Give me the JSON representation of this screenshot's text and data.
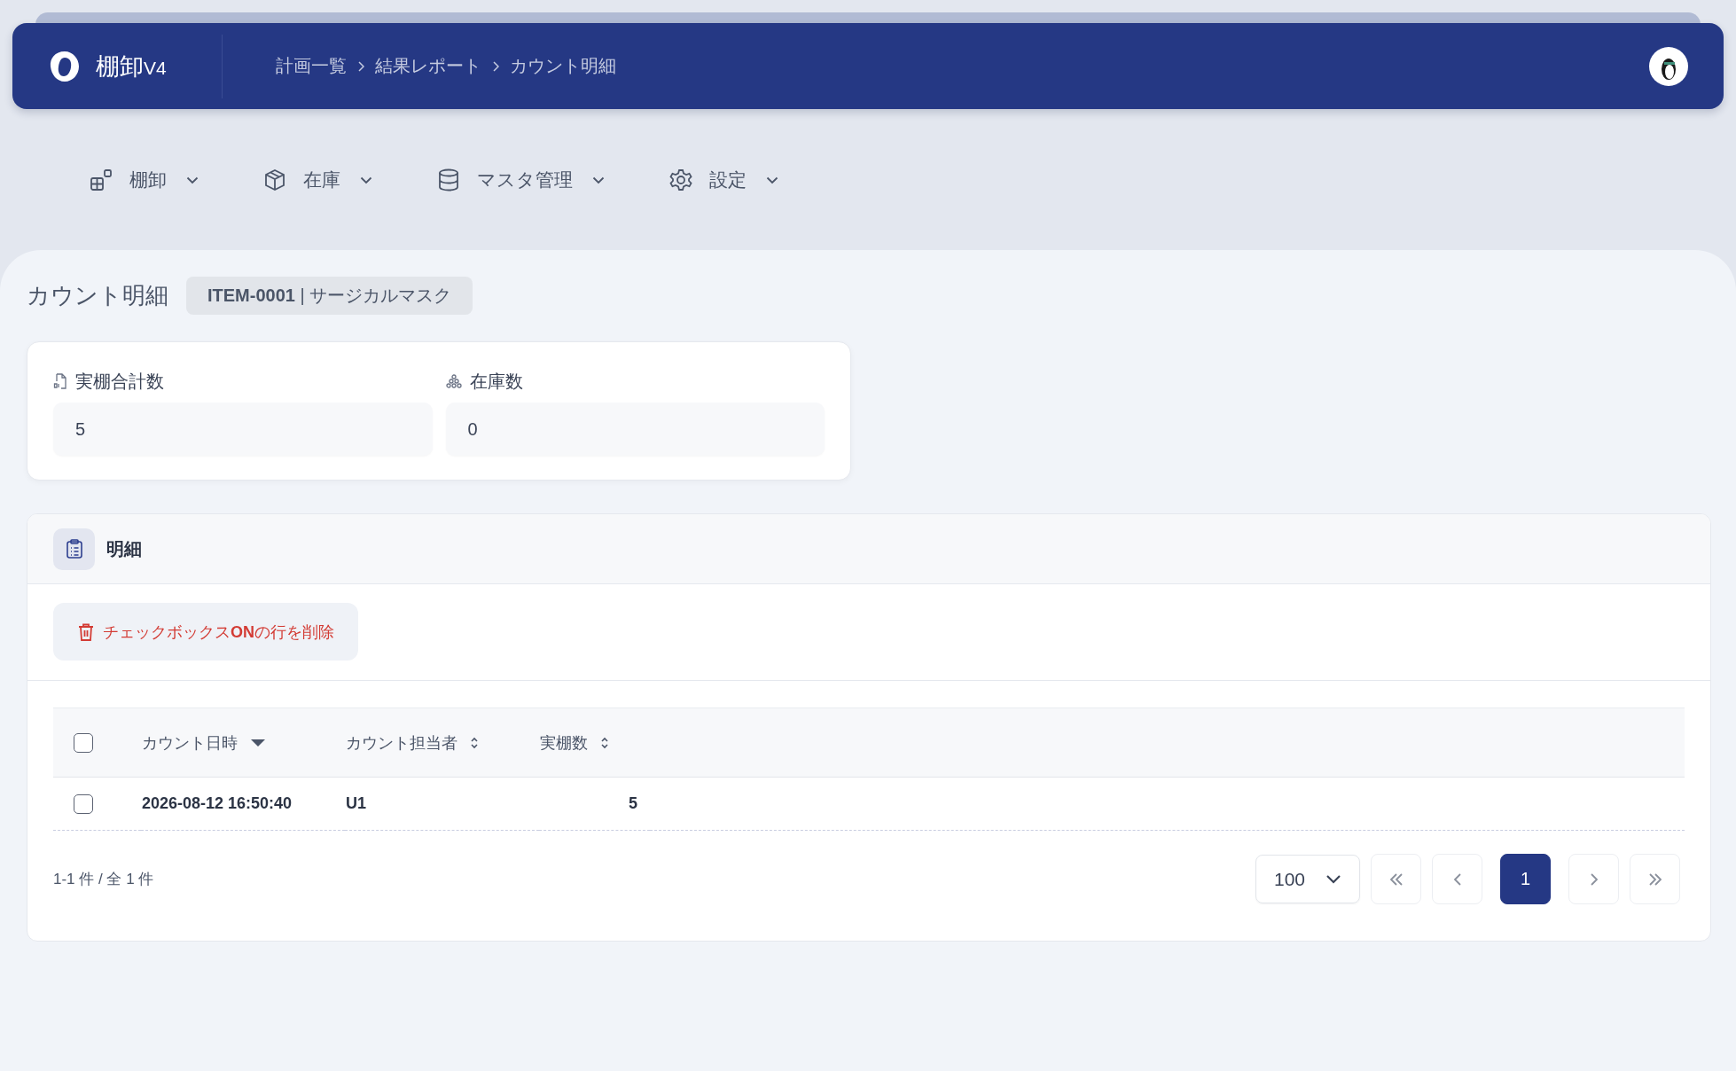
{
  "app": {
    "name": "棚卸",
    "version": "V4"
  },
  "breadcrumb": [
    "計画一覧",
    "結果レポート",
    "カウント明細"
  ],
  "nav": [
    {
      "label": "棚卸"
    },
    {
      "label": "在庫"
    },
    {
      "label": "マスタ管理"
    },
    {
      "label": "設定"
    }
  ],
  "page": {
    "title": "カウント明細",
    "tag": "**ITEM-0001** | サージカルマスク"
  },
  "stats": [
    {
      "label": "実棚合計数",
      "value": "5"
    },
    {
      "label": "在庫数",
      "value": "0"
    }
  ],
  "detail": {
    "title": "明細",
    "delete_button": "チェックボックス**ON**の行を削除"
  },
  "table": {
    "all_checked": false,
    "columns": [
      {
        "label": "カウント日時",
        "sorted": true
      },
      {
        "label": "カウント担当者",
        "sorted": false
      },
      {
        "label": "実棚数",
        "sorted": false
      }
    ],
    "rows": [
      {
        "checked": false,
        "cells": [
          "2026-08-12 16:50:40",
          "U1",
          "5"
        ]
      }
    ]
  },
  "pagination": {
    "summary": "1-1 件 / 全 1 件",
    "page_size": "100",
    "pages": [
      {
        "label": "1",
        "selected": true
      }
    ]
  }
}
